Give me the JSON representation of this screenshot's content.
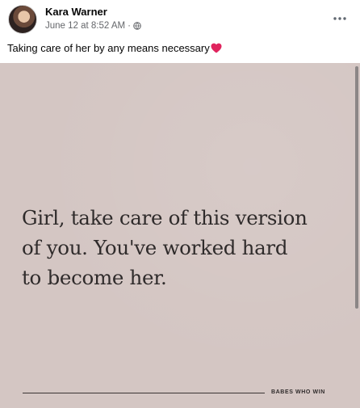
{
  "post": {
    "author": "Kara Warner",
    "timestamp": "June 12 at 8:52 AM",
    "separator": "·",
    "audience_icon": "globe-icon",
    "more_icon": "more-options-icon",
    "caption": "Taking care of her by any means necessary",
    "caption_emoji": "heart-icon"
  },
  "image": {
    "quote_lines": [
      "Girl, take care of this version",
      "of you. You've worked hard",
      "to become her."
    ],
    "brand": "BABES WHO WIN"
  },
  "colors": {
    "image_background": "#d4c6c3",
    "quote_text": "#2f2b2b",
    "meta_text": "#65676b",
    "heart": "#e0245e"
  }
}
